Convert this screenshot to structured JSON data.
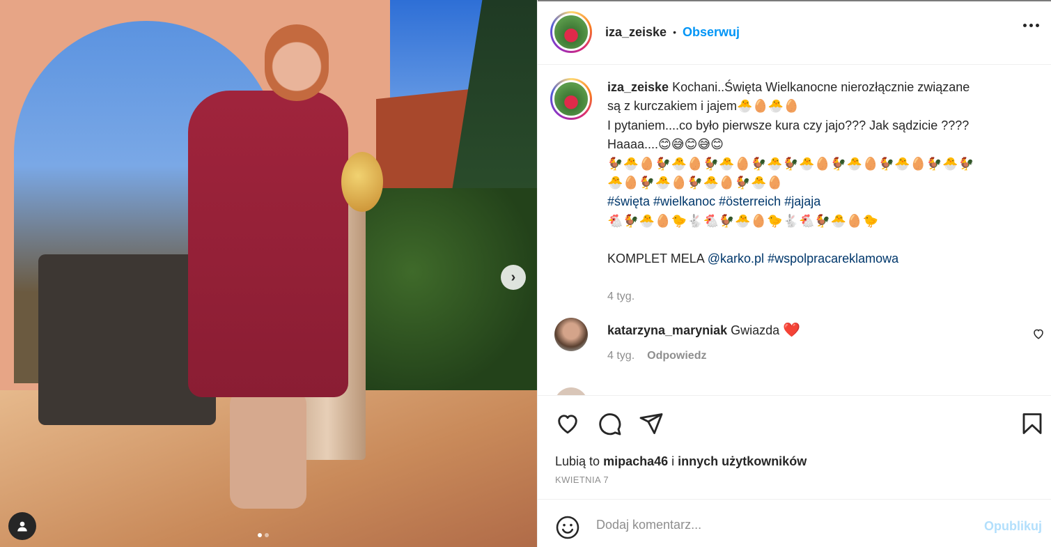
{
  "post": {
    "username": "iza_zeiske",
    "separator": "•",
    "follow_label": "Obserwuj",
    "more_icon": "more-horizontal-icon"
  },
  "caption": {
    "username": "iza_zeiske",
    "line1": "Kochani..Święta Wielkanocne nierozłącznie związane",
    "line2": "są z kurczakiem i jajem🐣🥚🐣🥚",
    "line3": "I pytaniem....co było pierwsze kura czy jajo??? Jak sądzicie ????",
    "line4": "Haaaa....😊😅😊😅😊",
    "line5": "🐓🐣🥚🐓🐣🥚🐓🐣🥚🐓🐣🐓🐣🥚🐓🐣🥚🐓🐣🥚🐓🐣🐓",
    "line6": "🐣🥚🐓🐣🥚🐓🐣🥚🐓🐣🥚",
    "hashtags": [
      "#święta",
      "#wielkanoc",
      "#österreich",
      "#jajaja"
    ],
    "line8": "🐔🐓🐣🥚🐤🐇🐔🐓🐣🥚🐤🐇🐔🐓🐣🥚🐤",
    "sponsor_prefix": "KOMPLET MELA",
    "mention": "@karko.pl",
    "sponsor_tag": "#wspolpracareklamowa",
    "time": "4 tyg."
  },
  "comment": {
    "username": "katarzyna_maryniak",
    "text": "Gwiazda",
    "emoji": "❤️",
    "time": "4 tyg.",
    "reply_label": "Odpowiedz"
  },
  "likes": {
    "prefix": "Lubią to",
    "user": "mipacha46",
    "conj": "i",
    "others": "innych użytkowników"
  },
  "date": "KWIETNIA 7",
  "comment_box": {
    "placeholder": "Dodaj komentarz...",
    "publish_label": "Opublikuj"
  },
  "carousel": {
    "next_label": "›",
    "slide_count": 2,
    "active_slide": 1
  },
  "colors": {
    "accent": "#0095f6",
    "link": "#00376b",
    "muted": "#8e8e8e",
    "publish_disabled": "#b2dffc"
  }
}
